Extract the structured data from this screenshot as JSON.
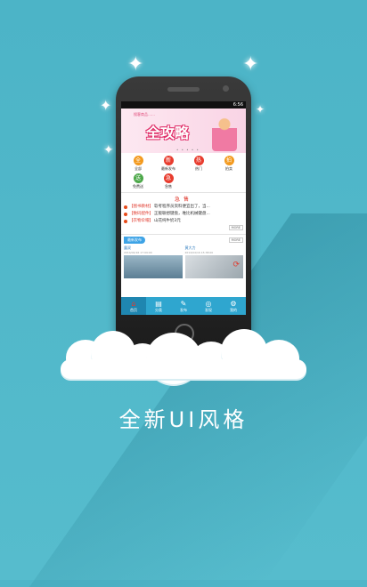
{
  "caption": "全新UI风格",
  "status_bar": {
    "time": "6:56"
  },
  "banner": {
    "tag_text": "搜客商品……",
    "title": "全攻略",
    "dots": "• • • • •"
  },
  "categories": [
    {
      "label": "全部",
      "icon": "全"
    },
    {
      "label": "最新发布",
      "icon": "新"
    },
    {
      "label": "热门",
      "icon": "热"
    },
    {
      "label": "拍卖",
      "icon": "拍"
    },
    {
      "label": "免费送",
      "icon": "送"
    },
    {
      "label": "急售",
      "icon": "急"
    }
  ],
  "urgent": {
    "title": "急售",
    "more": "MORE",
    "items": [
      {
        "category": "【图书教材】",
        "text": "软考程序员资料便宜出了，当..."
      },
      {
        "category": "【数码配件】",
        "text": "正版联想键盘，堆比机械键盘..."
      },
      {
        "category": "【衣物伞帽】",
        "text": "山花纯牛奶3元"
      }
    ]
  },
  "latest": {
    "title": "最新发布",
    "more": "MORE",
    "cards": [
      {
        "name": "露双",
        "time": "2014/04/16 17:09:00"
      },
      {
        "name": "黄大力",
        "time": "2014/04/16 15:38:00"
      }
    ]
  },
  "tabs": [
    {
      "label": "首页",
      "icon": "⌂"
    },
    {
      "label": "分类",
      "icon": "▤"
    },
    {
      "label": "发布",
      "icon": "✎"
    },
    {
      "label": "发现",
      "icon": "◎"
    },
    {
      "label": "我的",
      "icon": "⚙"
    }
  ],
  "colors": {
    "background": "#4fb6c9",
    "accent": "#2fa6cf",
    "urgent": "#e03a2e"
  }
}
